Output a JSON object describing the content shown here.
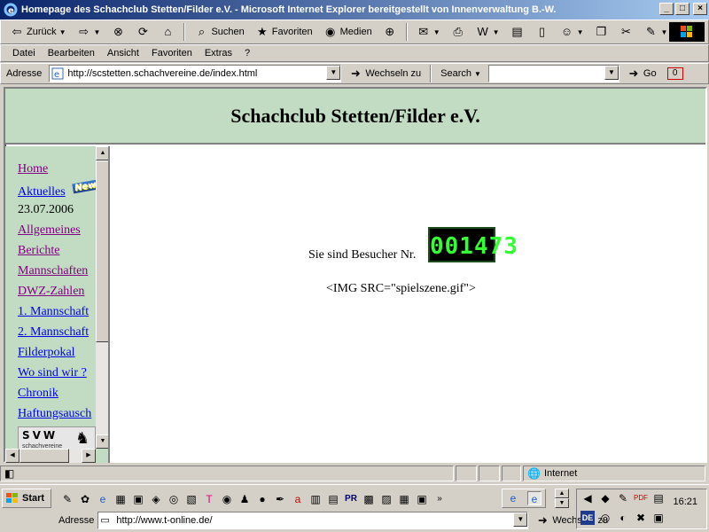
{
  "window": {
    "title": "Homepage des Schachclub Stetten/Filder e.V. - Microsoft Internet Explorer bereitgestellt von Innenverwaltung B.-W.",
    "controls": [
      "_",
      "□",
      "×"
    ]
  },
  "toolbar": {
    "back_label": "Zurück",
    "search_label": "Suchen",
    "favorites_label": "Favoriten",
    "media_label": "Medien"
  },
  "menu": [
    "Datei",
    "Bearbeiten",
    "Ansicht",
    "Favoriten",
    "Extras",
    "?"
  ],
  "address_bar": {
    "label": "Adresse",
    "url": "http://scstetten.schachvereine.de/index.html",
    "go_label": "Wechseln zu",
    "search_label": "Search",
    "go_button": "Go",
    "counter_badge": "0"
  },
  "page": {
    "title": "Schachclub Stetten/Filder e.V.",
    "nav": [
      {
        "label": "Home",
        "visited": true
      },
      {
        "label": "Aktuelles",
        "visited": false
      },
      {
        "label": "Allgemeines",
        "visited": true
      },
      {
        "label": "Berichte",
        "visited": true
      },
      {
        "label": "Mannschaften",
        "visited": true
      },
      {
        "label": "DWZ-Zahlen",
        "visited": true
      },
      {
        "label": "1. Mannschaft",
        "visited": false
      },
      {
        "label": "2. Mannschaft",
        "visited": false
      },
      {
        "label": "Filderpokal",
        "visited": false
      },
      {
        "label": "Wo sind wir ?",
        "visited": false
      },
      {
        "label": "Chronik",
        "visited": false
      },
      {
        "label": "Haftungsausch",
        "visited": false
      }
    ],
    "new_badge": "New",
    "news_date": "23.07.2006",
    "svw_logo": "SVW",
    "svw_subtext": "schachvereine",
    "visitor_text": "Sie sind Besucher Nr.",
    "visitor_count": "001473",
    "img_alt": "<IMG SRC=\"spielszene.gif\">"
  },
  "status_bar": {
    "zone": "Internet"
  },
  "taskbar": {
    "start_label": "Start",
    "address_label": "Adresse",
    "address_url": "http://www.t-online.de/",
    "go_label": "Wechseln zu",
    "clock": "16:21",
    "tray_de": "DE"
  }
}
